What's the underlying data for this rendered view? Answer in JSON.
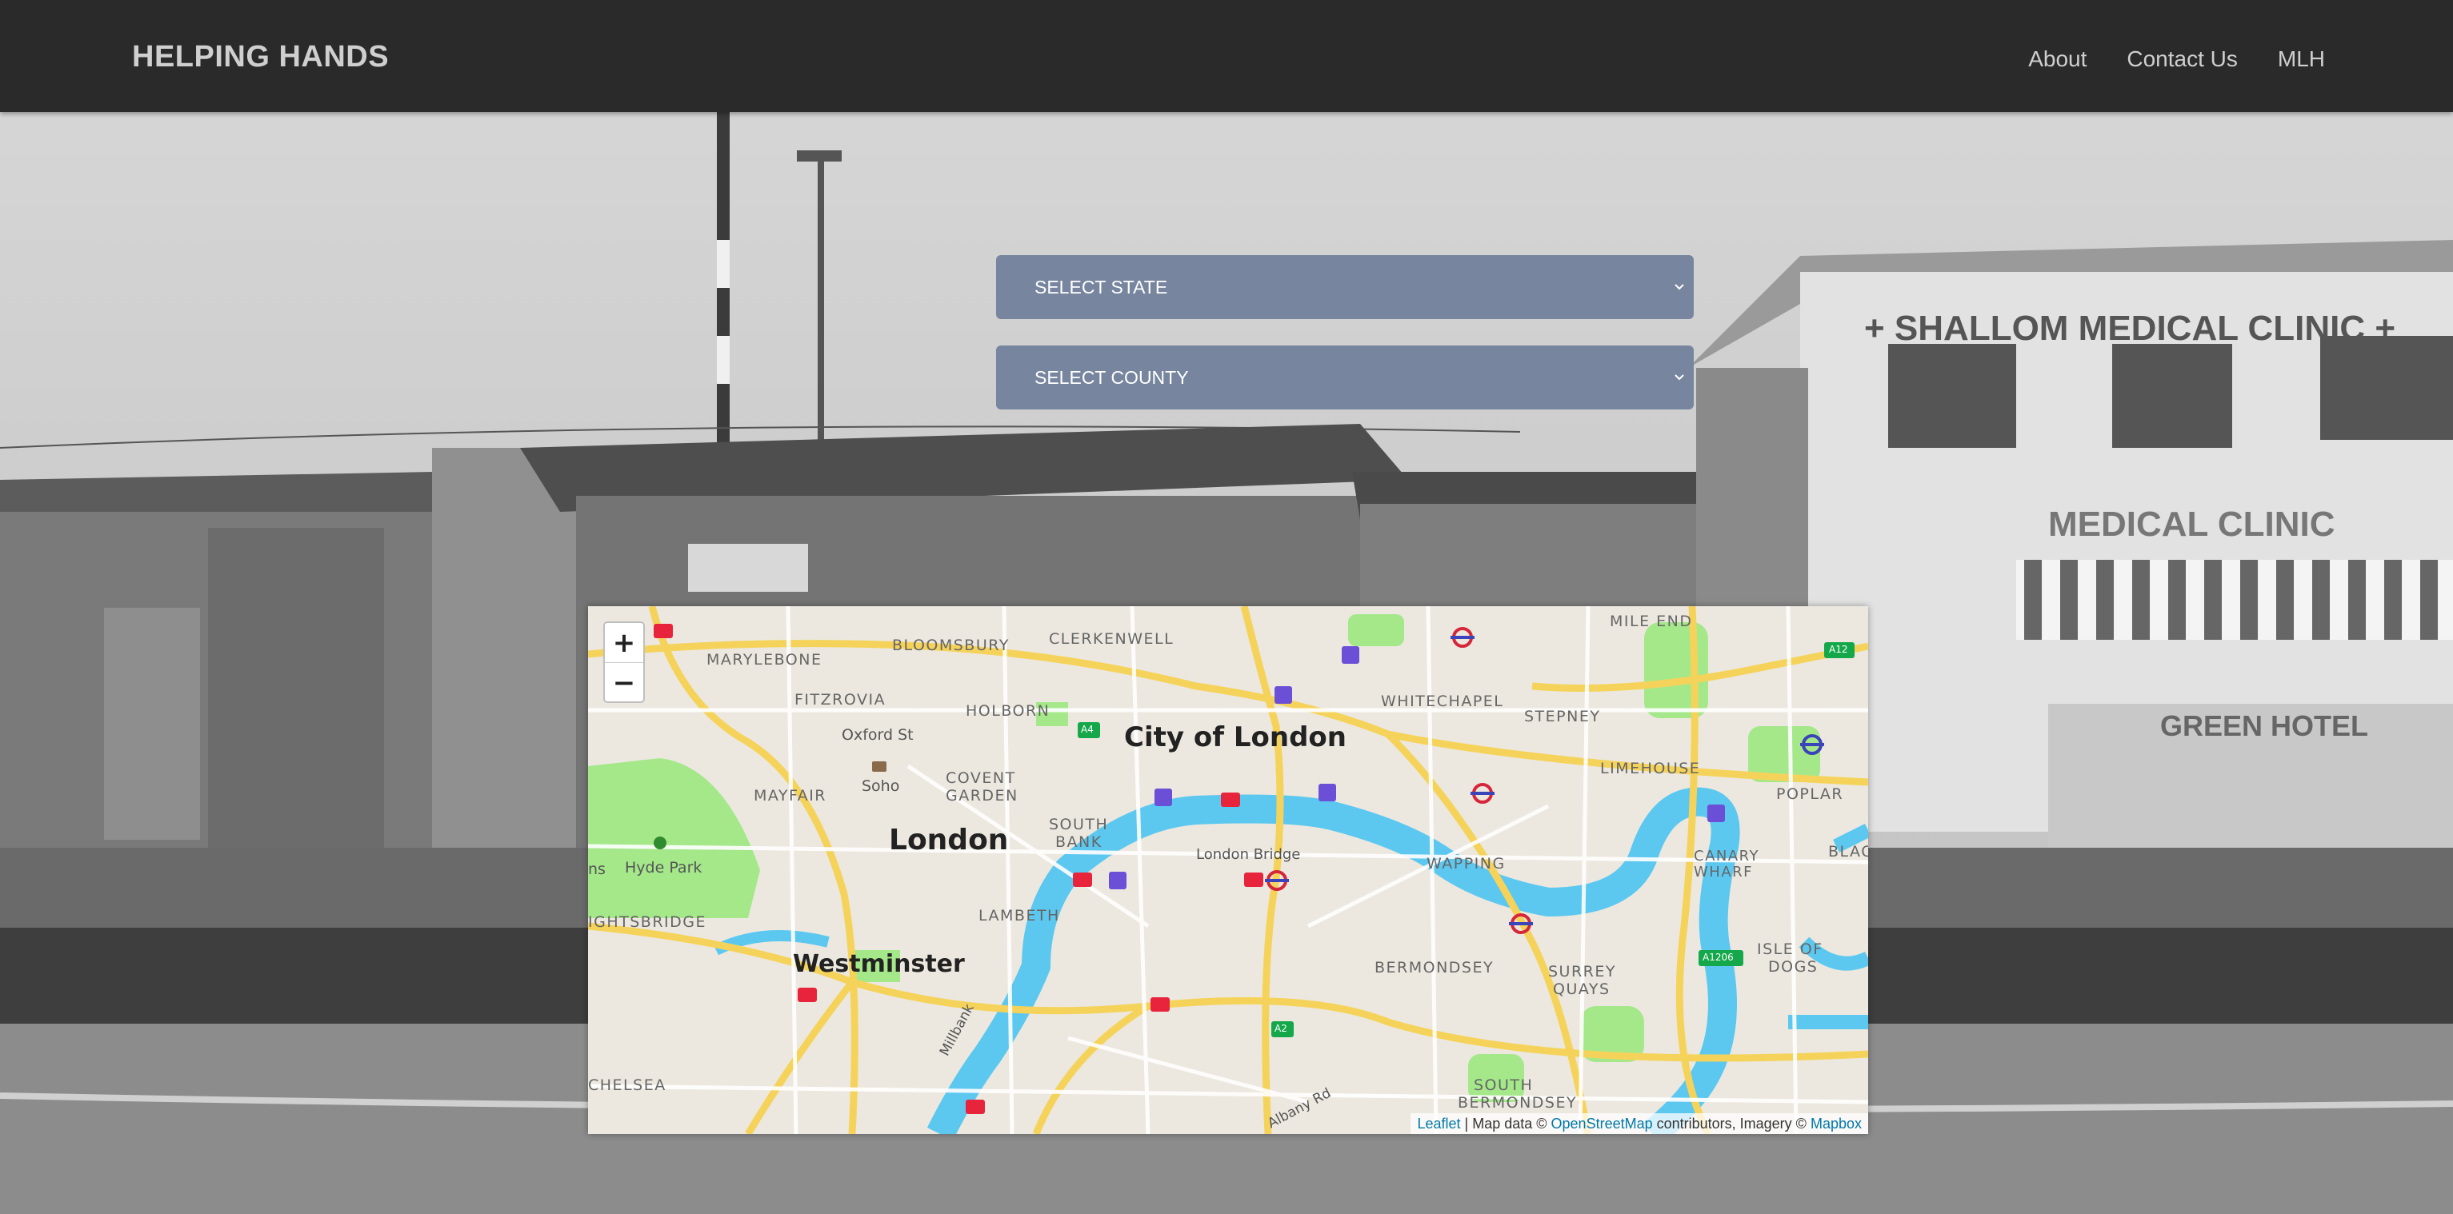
{
  "header": {
    "brand": "HELPING HANDS",
    "nav": [
      {
        "label": "About"
      },
      {
        "label": "Contact Us"
      },
      {
        "label": "MLH"
      }
    ]
  },
  "filters": {
    "state": "SELECT STATE",
    "county": "SELECT COUNTY"
  },
  "background_signs": {
    "clinic_sign": "+ SHALLOM MEDICAL CLINIC +",
    "clinic_sign_lower": "MEDICAL CLINIC",
    "hotel_sign": "GREEN HOTEL"
  },
  "map": {
    "zoom_in": "+",
    "zoom_out": "−",
    "labels": {
      "city_of_london": "City of London",
      "london": "London",
      "westminster": "Westminster",
      "marylebone": "MARYLEBONE",
      "bloomsbury": "BLOOMSBURY",
      "clerkenwell": "CLERKENWELL",
      "fitzrovia": "FITZROVIA",
      "holborn": "HOLBORN",
      "oxford_st": "Oxford St",
      "soho": "Soho",
      "covent_garden_1": "COVENT",
      "covent_garden_2": "GARDEN",
      "mayfair": "MAYFAIR",
      "hyde_park": "Hyde Park",
      "knightsbridge": "IGHTSBRIDGE",
      "south_bank_1": "SOUTH",
      "south_bank_2": "BANK",
      "london_bridge": "London Bridge",
      "lambeth": "LAMBETH",
      "whitechapel": "WHITECHAPEL",
      "stepney": "STEPNEY",
      "mile_end": "MILE END",
      "limehouse": "LIMEHOUSE",
      "poplar": "POPLAR",
      "wapping": "WAPPING",
      "canary_wharf_1": "CANARY",
      "canary_wharf_2": "WHARF",
      "isle_of_dogs_1": "ISLE OF",
      "isle_of_dogs_2": "DOGS",
      "bermondsey": "BERMONDSEY",
      "surrey_quays_1": "SURREY",
      "surrey_quays_2": "QUAYS",
      "south_bermondsey_1": "SOUTH",
      "south_bermondsey_2": "BERMONDSEY",
      "chelsea": "CHELSEA",
      "millbank": "Millbank",
      "albany_rd": "Albany Rd",
      "blac": "BLAC",
      "ns": "ns",
      "road_a4": "A4",
      "road_a2": "A2",
      "road_a12": "A12",
      "road_a1206": "A1206"
    },
    "attribution": {
      "leaflet": "Leaflet",
      "mid": " | Map data © ",
      "osm": "OpenStreetMap",
      "mid2": " contributors, Imagery © ",
      "mapbox": "Mapbox"
    }
  },
  "colors": {
    "navbar": "#2a2a2a",
    "select_bg": "#77869e",
    "water": "#5cc8f0",
    "park": "#a4e88a",
    "road": "#f5d35b"
  }
}
